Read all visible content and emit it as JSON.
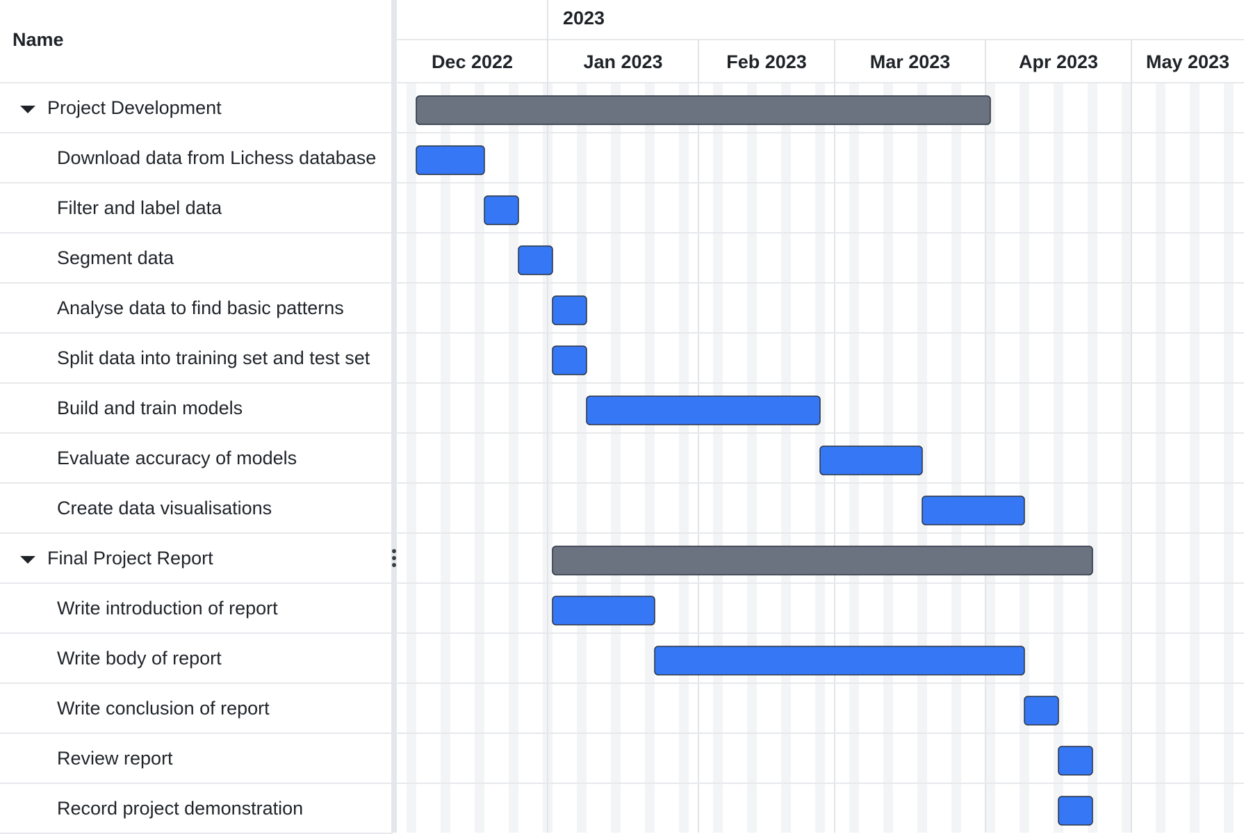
{
  "grid": {
    "name_header": "Name"
  },
  "timeline": {
    "year_label": "2023",
    "months": [
      "Dec 2022",
      "Jan 2023",
      "Feb 2023",
      "Mar 2023",
      "Apr 2023",
      "May 2023"
    ]
  },
  "colors": {
    "group_bar": "#6b7280",
    "task_bar": "#3577f5",
    "bar_border": "#2a3340",
    "grid_line": "#e6e8eb",
    "weekend_stripe": "#f3f4f6"
  },
  "chart_data": {
    "type": "gantt",
    "x_axis": "date",
    "range": [
      "2022-12-01",
      "2023-05-31"
    ],
    "rows": [
      {
        "name": "Project Development",
        "type": "group",
        "start": "2022-12-05",
        "end": "2023-04-02"
      },
      {
        "name": "Download data from Lichess database",
        "type": "task",
        "start": "2022-12-05",
        "end": "2022-12-19"
      },
      {
        "name": "Filter and label data",
        "type": "task",
        "start": "2022-12-19",
        "end": "2022-12-26"
      },
      {
        "name": "Segment data",
        "type": "task",
        "start": "2022-12-26",
        "end": "2023-01-02"
      },
      {
        "name": "Analyse data to find basic patterns",
        "type": "task",
        "start": "2023-01-02",
        "end": "2023-01-09"
      },
      {
        "name": "Split data into training set and test set",
        "type": "task",
        "start": "2023-01-02",
        "end": "2023-01-09"
      },
      {
        "name": "Build and train models",
        "type": "task",
        "start": "2023-01-09",
        "end": "2023-02-26"
      },
      {
        "name": "Evaluate accuracy of models",
        "type": "task",
        "start": "2023-02-26",
        "end": "2023-03-19"
      },
      {
        "name": "Create data visualisations",
        "type": "task",
        "start": "2023-03-19",
        "end": "2023-04-09"
      },
      {
        "name": "Final Project Report",
        "type": "group",
        "start": "2023-01-02",
        "end": "2023-04-23"
      },
      {
        "name": "Write introduction of report",
        "type": "task",
        "start": "2023-01-02",
        "end": "2023-01-23"
      },
      {
        "name": "Write body of report",
        "type": "task",
        "start": "2023-01-23",
        "end": "2023-04-09"
      },
      {
        "name": "Write conclusion of report",
        "type": "task",
        "start": "2023-04-09",
        "end": "2023-04-16"
      },
      {
        "name": "Review report",
        "type": "task",
        "start": "2023-04-16",
        "end": "2023-04-23"
      },
      {
        "name": "Record project demonstration",
        "type": "task",
        "start": "2023-04-16",
        "end": "2023-04-23"
      }
    ]
  }
}
